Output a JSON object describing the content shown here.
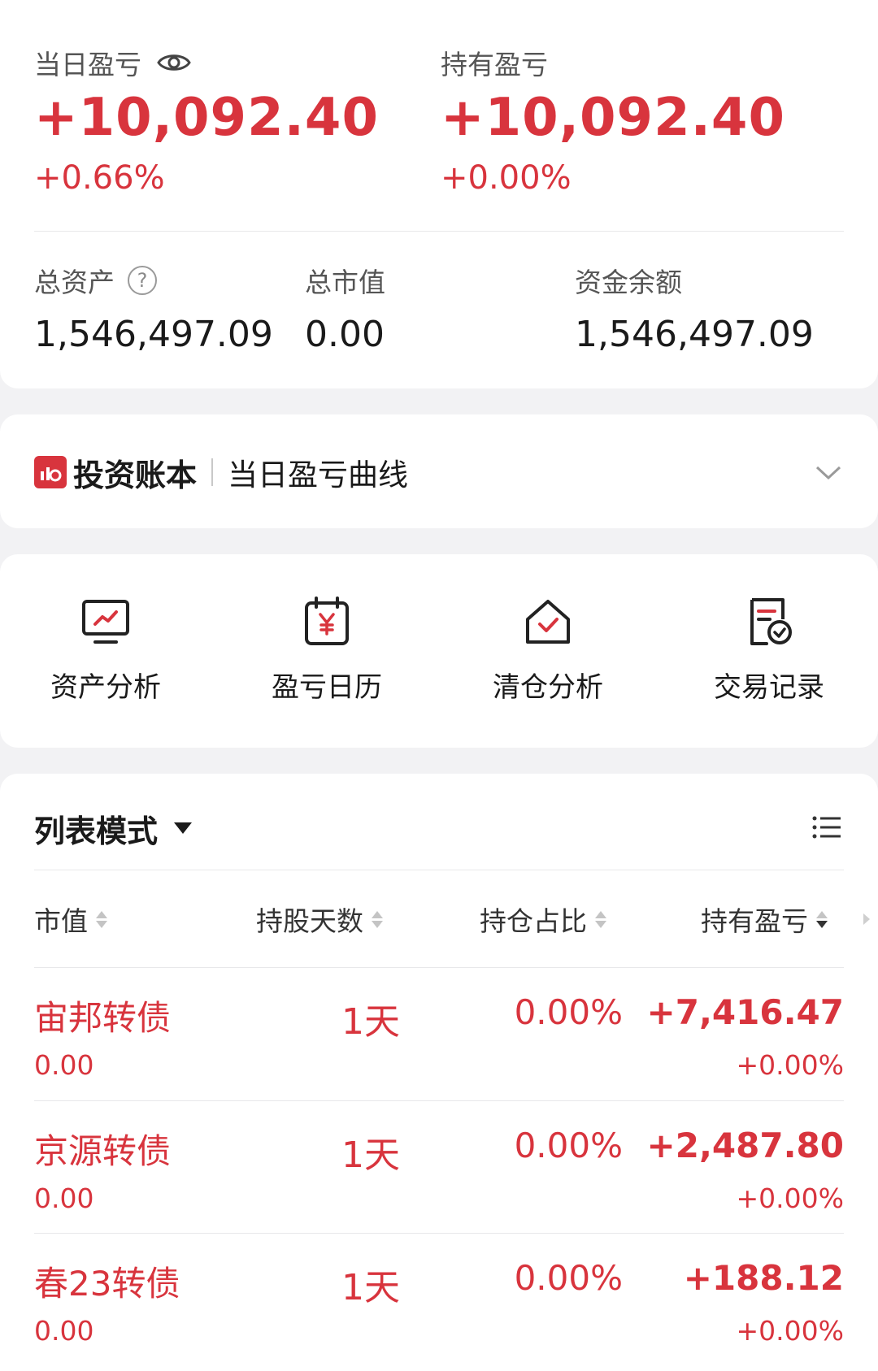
{
  "summary": {
    "daily_pnl_label": "当日盈亏",
    "daily_pnl_value": "+10,092.40",
    "daily_pnl_pct": "+0.66%",
    "holding_pnl_label": "持有盈亏",
    "holding_pnl_value": "+10,092.40",
    "holding_pnl_pct": "+0.00%",
    "total_assets_label": "总资产",
    "total_assets_value": "1,546,497.09",
    "market_value_label": "总市值",
    "market_value_value": "0.00",
    "cash_balance_label": "资金余额",
    "cash_balance_value": "1,546,497.09"
  },
  "ledger": {
    "brand": "投资账本",
    "subtitle": "当日盈亏曲线"
  },
  "tools": [
    {
      "label": "资产分析",
      "icon": "monitor-chart-icon"
    },
    {
      "label": "盈亏日历",
      "icon": "calendar-yen-icon"
    },
    {
      "label": "清仓分析",
      "icon": "house-check-icon"
    },
    {
      "label": "交易记录",
      "icon": "document-clock-icon"
    }
  ],
  "holdings": {
    "mode_label": "列表模式",
    "columns": [
      "市值",
      "持股天数",
      "持仓占比",
      "持有盈亏"
    ],
    "rows": [
      {
        "name": "宙邦转债",
        "market_value": "0.00",
        "days": "1天",
        "ratio": "0.00%",
        "pnl": "+7,416.47",
        "pnl_pct": "+0.00%"
      },
      {
        "name": "京源转债",
        "market_value": "0.00",
        "days": "1天",
        "ratio": "0.00%",
        "pnl": "+2,487.80",
        "pnl_pct": "+0.00%"
      },
      {
        "name": "春23转债",
        "market_value": "0.00",
        "days": "1天",
        "ratio": "0.00%",
        "pnl": "+188.12",
        "pnl_pct": "+0.00%"
      }
    ]
  },
  "colors": {
    "accent_red": "#d8343d",
    "background": "#f2f2f4",
    "card": "#ffffff"
  }
}
